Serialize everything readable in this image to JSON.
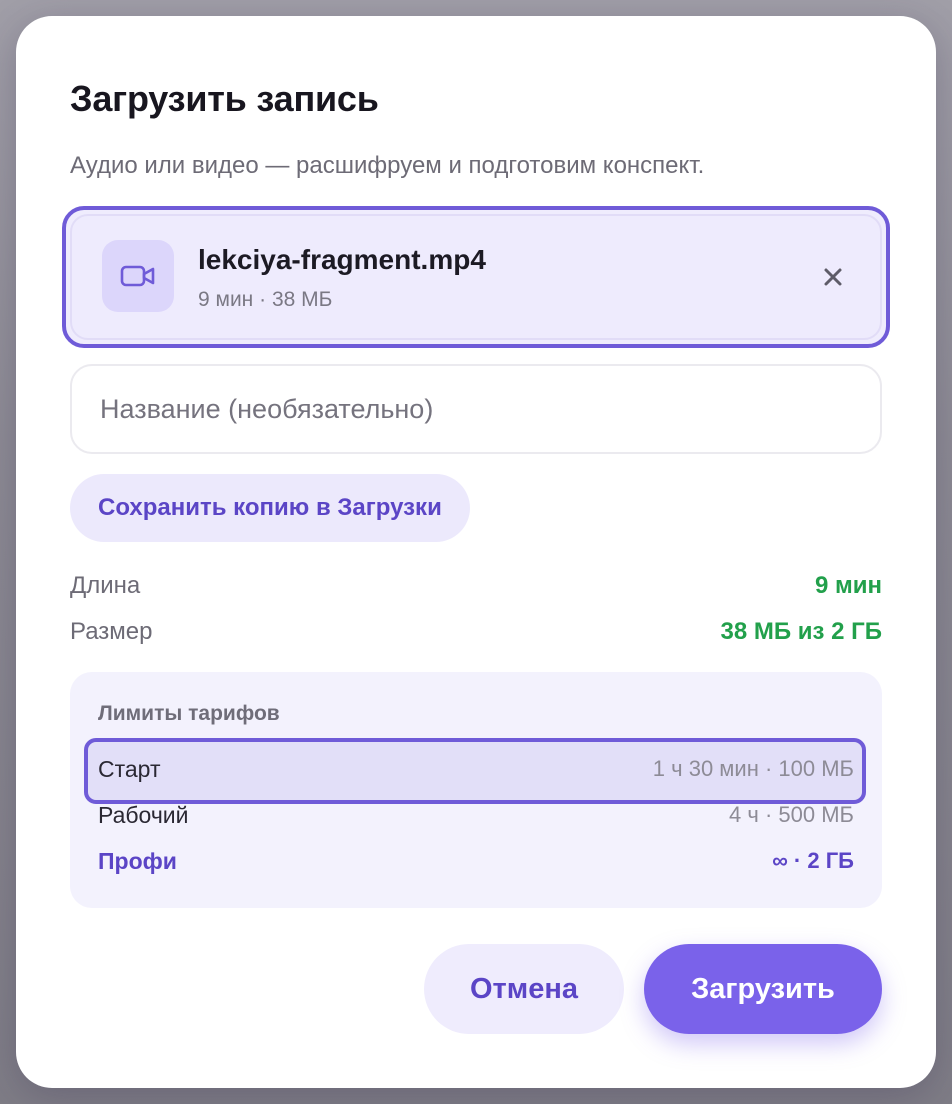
{
  "dialog": {
    "title": "Загрузить запись",
    "subtitle": "Аудио или видео — расшифруем и подготовим конспект."
  },
  "file": {
    "icon": "video-camera-icon",
    "name": "lekciya-fragment.mp4",
    "meta": "9 мин · 38 МБ"
  },
  "name_field": {
    "value": "",
    "placeholder": "Название (необязательно)"
  },
  "save_copy_label": "Сохранить копию в Загрузки",
  "info": {
    "length_label": "Длина",
    "length_value": "9 мин",
    "size_label": "Размер",
    "size_value": "38 МБ из 2 ГБ"
  },
  "limits": {
    "title": "Лимиты тарифов",
    "tiers": [
      {
        "name": "Старт",
        "limit": "1 ч 30 мин · 100 МБ",
        "highlighted": true
      },
      {
        "name": "Рабочий",
        "limit": "4 ч · 500 МБ"
      },
      {
        "name": "Профи",
        "limit": "∞ · 2 ГБ"
      }
    ]
  },
  "buttons": {
    "cancel": "Отмена",
    "upload": "Загрузить"
  },
  "colors": {
    "accent": "#7a62ea",
    "accent_text": "#5b45c6",
    "success": "#22a04b"
  }
}
